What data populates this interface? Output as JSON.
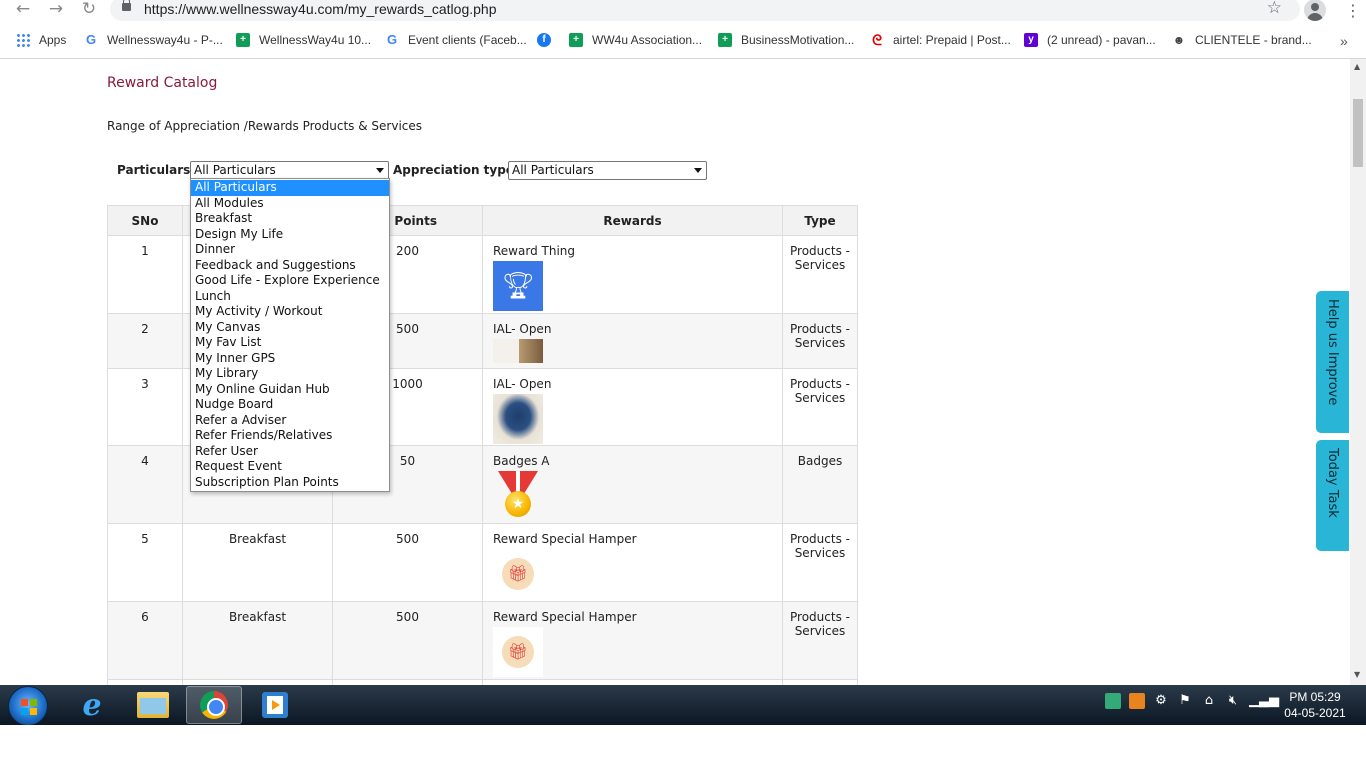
{
  "browser": {
    "url": "https://www.wellnessway4u.com/my_rewards_catlog.php",
    "bookmarks": [
      {
        "label": "Apps",
        "icon": "apps-grid-icon"
      },
      {
        "label": "Wellnessway4u - P-...",
        "icon": "google-icon"
      },
      {
        "label": "WellnessWay4u 10...",
        "icon": "green-plus-icon"
      },
      {
        "label": "Event clients (Faceb...",
        "icon": "google-icon"
      },
      {
        "label": "",
        "icon": "facebook-icon"
      },
      {
        "label": "WW4u Association...",
        "icon": "green-plus-icon"
      },
      {
        "label": "BusinessMotivation...",
        "icon": "green-plus-icon"
      },
      {
        "label": "airtel: Prepaid | Post...",
        "icon": "airtel-icon"
      },
      {
        "label": "(2 unread) - pavan...",
        "icon": "yahoo-icon"
      },
      {
        "label": "CLIENTELE - brand...",
        "icon": "clientele-icon"
      }
    ]
  },
  "page": {
    "title": "Reward Catalog",
    "subtitle": "Range of Appreciation /Rewards Products & Services",
    "filters": {
      "particulars_label": "Particulars:",
      "particulars_value": "All Particulars",
      "appreciation_label": "Appreciation type:",
      "appreciation_value": "All Particulars"
    },
    "dropdown_options": [
      "All Particulars",
      "All Modules",
      "Breakfast",
      "Design My Life",
      "Dinner",
      "Feedback and Suggestions",
      "Good Life - Explore Experience",
      "Lunch",
      "My Activity / Workout",
      "My Canvas",
      "My Fav List",
      "My Inner GPS",
      "My Library",
      "My Online Guidan Hub",
      "Nudge Board",
      "Refer a Adviser",
      "Refer Friends/Relatives",
      "Refer User",
      "Request Event",
      "Subscription Plan Points"
    ],
    "table": {
      "headers": [
        "SNo",
        "",
        "al Points",
        "Rewards",
        "Type"
      ],
      "rows": [
        {
          "sno": "1",
          "particular": "",
          "points": "200",
          "reward": "Reward Thing",
          "type": "Products - Services",
          "image": "trophy"
        },
        {
          "sno": "2",
          "particular": "",
          "points": "500",
          "reward": "IAL- Open",
          "type": "Products - Services",
          "image": "note"
        },
        {
          "sno": "3",
          "particular": "",
          "points": "1000",
          "reward": "IAL- Open",
          "type": "Products - Services",
          "image": "bag"
        },
        {
          "sno": "4",
          "particular": "",
          "points": "50",
          "reward": "Badges A",
          "type": "Badges",
          "image": "medal"
        },
        {
          "sno": "5",
          "particular": "Breakfast",
          "points": "500",
          "reward": "Reward Special Hamper",
          "type": "Products - Services",
          "image": "gift"
        },
        {
          "sno": "6",
          "particular": "Breakfast",
          "points": "500",
          "reward": "Reward Special Hamper",
          "type": "Products - Services",
          "image": "gift"
        }
      ]
    },
    "side_tabs": [
      "Help us Improve",
      "Today Task"
    ]
  },
  "taskbar": {
    "time": "PM 05:29",
    "date": "04-05-2021"
  },
  "colors": {
    "title": "#8a1a3a",
    "side_tab": "#29b6d6",
    "dropdown_selected": "#1e90ff"
  }
}
